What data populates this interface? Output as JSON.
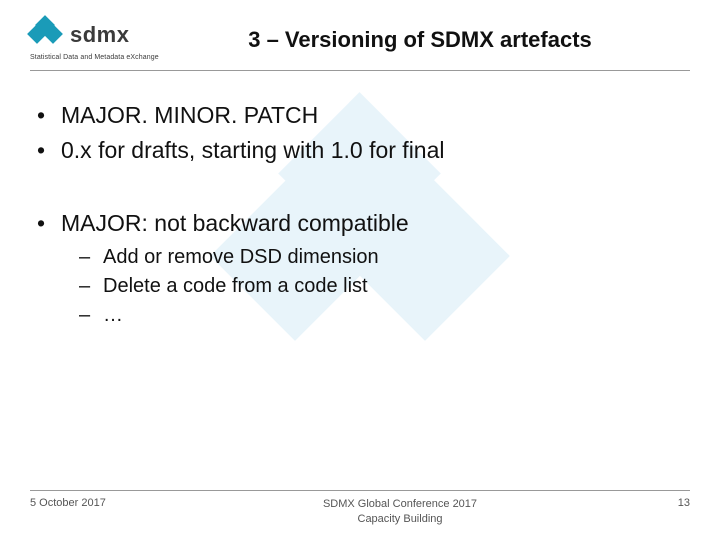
{
  "logo": {
    "name": "sdmx",
    "tagline": "Statistical Data and Metadata eXchange"
  },
  "title": "3 – Versioning of SDMX artefacts",
  "bullets": [
    "MAJOR. MINOR. PATCH",
    "0.x for drafts, starting with 1.0 for final"
  ],
  "bullets2_heading": "MAJOR: not backward compatible",
  "subbullets": [
    "Add or remove DSD dimension",
    "Delete a code from a code list",
    "…"
  ],
  "footer": {
    "date": "5 October 2017",
    "event_line1": "SDMX Global Conference 2017",
    "event_line2": "Capacity Building",
    "page": "13"
  }
}
